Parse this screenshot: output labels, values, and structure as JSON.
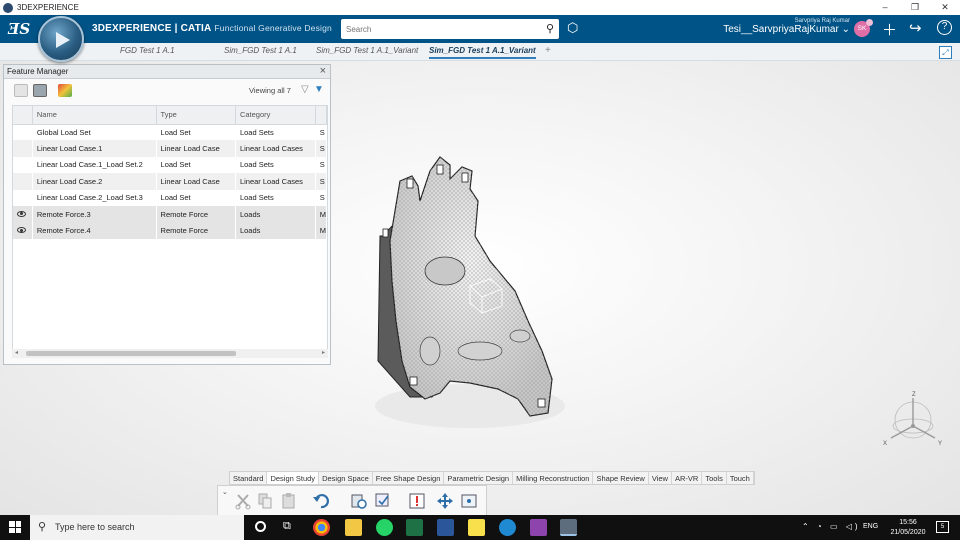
{
  "window": {
    "title": "3DEXPERIENCE",
    "controls": [
      "–",
      "❐",
      "✕"
    ]
  },
  "topbar": {
    "brand": "3DEXPERIENCE | CATIA",
    "app_name": "Functional Generative Design",
    "search_placeholder": "Search",
    "user_small": "Sarvpriya Raj Kumar",
    "user_name": "Tesi__SarvpriyaRajKumar",
    "avatar_initials": "SK"
  },
  "tabs": [
    {
      "label": "FGD Test 1 A.1",
      "active": false
    },
    {
      "label": "Sim_FGD Test 1 A.1",
      "active": false
    },
    {
      "label": "Sim_FGD Test 1 A.1_Variant",
      "active": false
    },
    {
      "label": "Sim_FGD Test 1 A.1_Variant",
      "active": true
    }
  ],
  "feature_manager": {
    "title": "Feature Manager",
    "viewing": "Viewing all 7",
    "columns": [
      "Name",
      "Type",
      "Category",
      ""
    ],
    "rows": [
      {
        "visible": false,
        "name": "Global Load Set",
        "type": "Load Set",
        "category": "Load Sets",
        "extra": "S"
      },
      {
        "visible": false,
        "name": "Linear Load Case.1",
        "type": "Linear Load Case",
        "category": "Linear Load Cases",
        "extra": "S"
      },
      {
        "visible": false,
        "name": "Linear Load Case.1_Load Set.2",
        "type": "Load Set",
        "category": "Load Sets",
        "extra": "S"
      },
      {
        "visible": false,
        "name": "Linear Load Case.2",
        "type": "Linear Load Case",
        "category": "Linear Load Cases",
        "extra": "S"
      },
      {
        "visible": false,
        "name": "Linear Load Case.2_Load Set.3",
        "type": "Load Set",
        "category": "Load Sets",
        "extra": "S"
      },
      {
        "visible": true,
        "name": "Remote Force.3",
        "type": "Remote Force",
        "category": "Loads",
        "extra": "M"
      },
      {
        "visible": true,
        "name": "Remote Force.4",
        "type": "Remote Force",
        "category": "Loads",
        "extra": "M"
      }
    ]
  },
  "compass_axes": {
    "x": "X",
    "y": "Y",
    "z": "Z"
  },
  "action_bar": {
    "sections": [
      "Standard",
      "Design Study",
      "Design Space",
      "Free Shape Design",
      "Parametric Design",
      "Milling Reconstruction",
      "Shape Review",
      "View",
      "AR-VR",
      "Tools",
      "Touch"
    ],
    "active_section": "Design Study"
  },
  "taskbar": {
    "search_placeholder": "Type here to search",
    "time": "15:56",
    "date": "21/05/2020",
    "language": "ENG",
    "notification_count": "5"
  },
  "colors": {
    "brand_blue": "#005386",
    "active_tab": "#2f7fbf",
    "avatar": "#e06fa8"
  }
}
